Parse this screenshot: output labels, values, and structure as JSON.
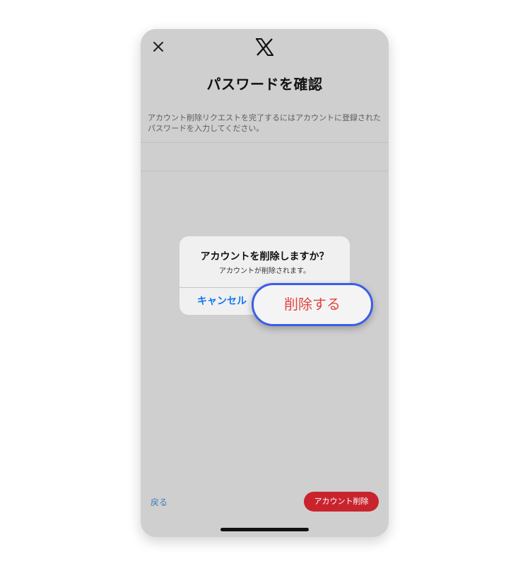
{
  "header": {
    "close_icon": "close-icon",
    "logo_icon": "x-logo-icon"
  },
  "page": {
    "title": "パスワードを確認",
    "description_line1": "アカウント削除リクエストを完了するにはアカウントに登録された",
    "description_line2": "パスワードを入力してください。"
  },
  "footer": {
    "back_label": "戻る",
    "delete_account_label": "アカウント削除"
  },
  "alert": {
    "title": "アカウントを削除しますか？",
    "message": "アカウントが削除されます。",
    "cancel_label": "キャンセル",
    "delete_label": "削除する"
  },
  "colors": {
    "background_overlay": "#cfcfd0",
    "cancel_blue": "#1478f0",
    "delete_red": "#e0463e",
    "danger_button": "#c9242d",
    "highlight_border": "#3b5ee8"
  }
}
